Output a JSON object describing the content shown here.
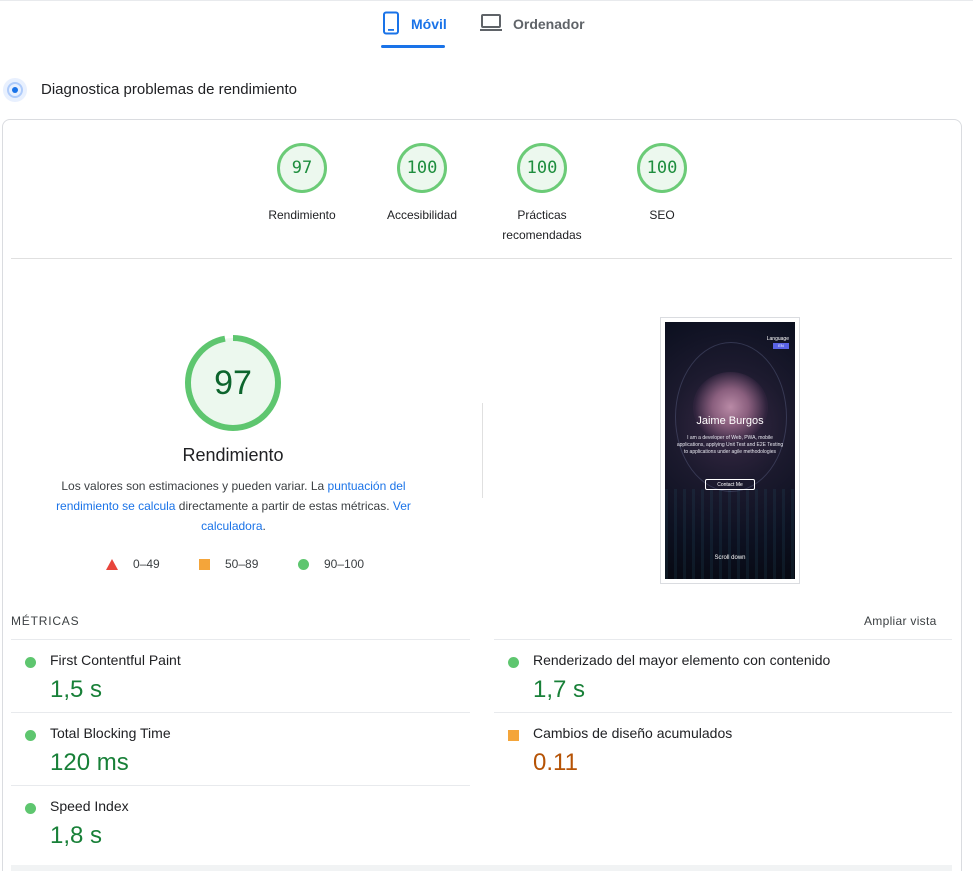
{
  "tabs": [
    {
      "label": "Móvil",
      "icon": "smartphone-icon",
      "active": true
    },
    {
      "label": "Ordenador",
      "icon": "laptop-icon",
      "active": false
    }
  ],
  "diagnose": {
    "title": "Diagnostica problemas de rendimiento",
    "icon": "diagnose-icon"
  },
  "categories": [
    {
      "score": "97",
      "label": "Rendimiento"
    },
    {
      "score": "100",
      "label": "Accesibilidad"
    },
    {
      "score": "100",
      "label": "Prácticas recomendadas"
    },
    {
      "score": "100",
      "label": "SEO"
    }
  ],
  "performance": {
    "score": "97",
    "score_fraction": 0.97,
    "label": "Rendimiento",
    "desc_1": "Los valores son estimaciones y pueden variar. La ",
    "link_1": "puntuación del rendimiento se calcula",
    "desc_2": " directamente a partir de estas métricas. ",
    "link_2": "Ver calculadora",
    "desc_3": "."
  },
  "legend": [
    {
      "range": "0–49",
      "shape": "triangle",
      "color": "#e8453c"
    },
    {
      "range": "50–89",
      "shape": "square",
      "color": "#f4a53a"
    },
    {
      "range": "90–100",
      "shape": "circle",
      "color": "#5ec66f"
    }
  ],
  "screenshot": {
    "language_label": "Language",
    "language_btn": "EN",
    "name": "Jaime Burgos",
    "tagline": "I am a developer of Web, PWA, mobile applications, applying Unit Test and E2E Testing to applications under agile methodologies",
    "button": "Contact Me",
    "scroll": "Scroll down"
  },
  "metrics": {
    "heading": "MÉTRICAS",
    "expand": "Ampliar vista",
    "items": [
      {
        "title": "First Contentful Paint",
        "value": "1,5 s",
        "status": "green"
      },
      {
        "title": "Renderizado del mayor elemento con contenido",
        "value": "1,7 s",
        "status": "green"
      },
      {
        "title": "Total Blocking Time",
        "value": "120 ms",
        "status": "green"
      },
      {
        "title": "Cambios de diseño acumulados",
        "value": "0.11",
        "status": "orange"
      },
      {
        "title": "Speed Index",
        "value": "1,8 s",
        "status": "green"
      }
    ]
  }
}
